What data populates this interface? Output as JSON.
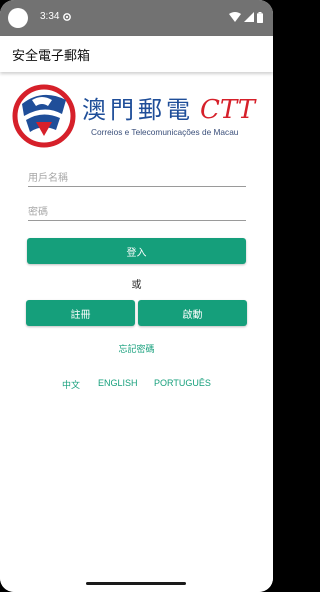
{
  "status_bar": {
    "time": "3:34",
    "icons": [
      "camera-cutout",
      "gear-icon",
      "wifi-icon",
      "signal-icon",
      "battery-icon"
    ]
  },
  "app_bar": {
    "title": "安全電子郵箱"
  },
  "logo": {
    "chinese_name": "澳門郵電",
    "brand": "CTT",
    "subtitle": "Correios e Telecomunicações de Macau",
    "colors": {
      "blue": "#1f4e99",
      "red": "#d6202a"
    }
  },
  "form": {
    "username_placeholder": "用戶名稱",
    "password_placeholder": "密碼",
    "login_label": "登入",
    "or_label": "或",
    "register_label": "註冊",
    "activate_label": "啟動",
    "forgot_label": "忘記密碼"
  },
  "languages": {
    "zh": "中文",
    "en": "ENGLISH",
    "pt": "PORTUGUÊS"
  },
  "colors": {
    "accent": "#159f7b",
    "status_bar": "#727272"
  }
}
